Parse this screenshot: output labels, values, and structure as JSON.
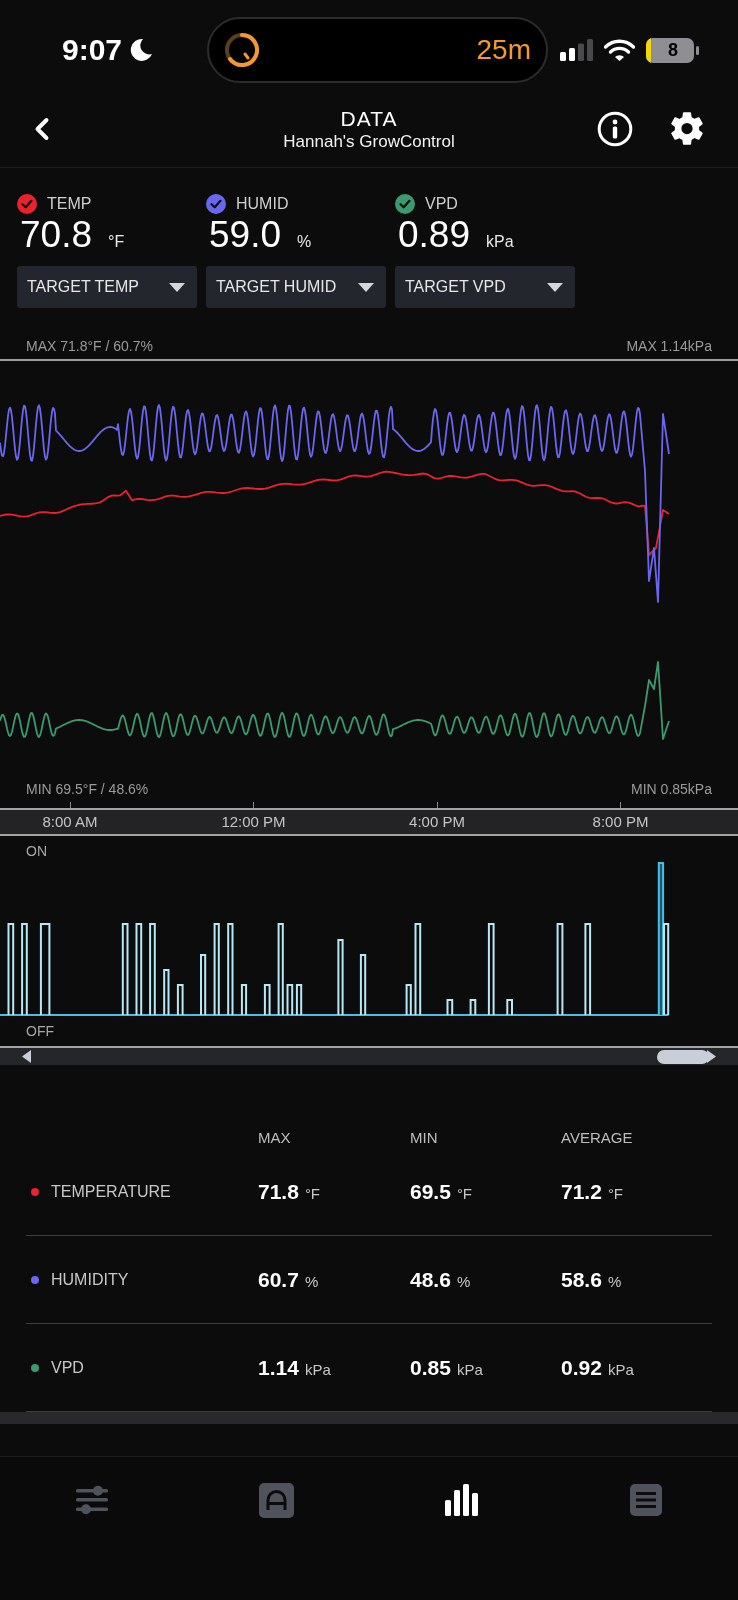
{
  "status_bar": {
    "time": "9:07",
    "timer": "25m",
    "battery": "8"
  },
  "header": {
    "title": "DATA",
    "subtitle": "Hannah's GrowControl"
  },
  "readings": [
    {
      "label": "TEMP",
      "value": "70.8",
      "unit": "°F",
      "checked": true,
      "color": "#e8232d",
      "target": "TARGET TEMP"
    },
    {
      "label": "HUMID",
      "value": "59.0",
      "unit": "%",
      "checked": true,
      "color": "#6a66f0",
      "target": "TARGET HUMID"
    },
    {
      "label": "VPD",
      "value": "0.89",
      "unit": "kPa",
      "checked": true,
      "color": "#3b9a70",
      "target": "TARGET VPD"
    }
  ],
  "chart": {
    "max_left": "MAX 71.8°F / 60.7%",
    "max_right": "MAX 1.14kPa",
    "min_left": "MIN 69.5°F / 48.6%",
    "min_right": "MIN 0.85kPa"
  },
  "time_axis": [
    "8:00 AM",
    "12:00 PM",
    "4:00 PM",
    "8:00 PM"
  ],
  "state_chart": {
    "on_label": "ON",
    "off_label": "OFF"
  },
  "stats": {
    "columns": [
      "MAX",
      "MIN",
      "AVERAGE"
    ],
    "rows": [
      {
        "name": "TEMPERATURE",
        "color": "#e8232d",
        "cells": [
          {
            "value": "71.8",
            "unit": "°F"
          },
          {
            "value": "69.5",
            "unit": "°F"
          },
          {
            "value": "71.2",
            "unit": "°F"
          }
        ]
      },
      {
        "name": "HUMIDITY",
        "color": "#6a66f0",
        "cells": [
          {
            "value": "60.7",
            "unit": "%"
          },
          {
            "value": "48.6",
            "unit": "%"
          },
          {
            "value": "58.6",
            "unit": "%"
          }
        ]
      },
      {
        "name": "VPD",
        "color": "#3b9a70",
        "cells": [
          {
            "value": "1.14",
            "unit": "kPa"
          },
          {
            "value": "0.85",
            "unit": "kPa"
          },
          {
            "value": "0.92",
            "unit": "kPa"
          }
        ]
      }
    ]
  },
  "tab_bar": [
    {
      "kind": "sliders",
      "selected": false
    },
    {
      "kind": "arch",
      "selected": false
    },
    {
      "kind": "bars",
      "selected": true
    },
    {
      "kind": "list",
      "selected": false
    }
  ]
}
